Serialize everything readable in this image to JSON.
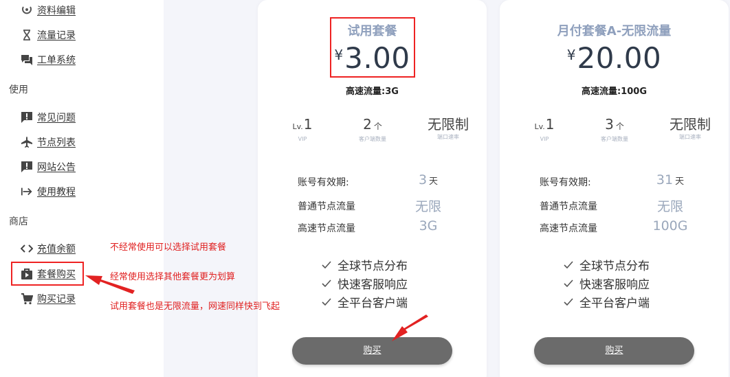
{
  "sidebar": {
    "items_top": [
      {
        "label": "资料编辑",
        "icon": "user-edit-icon"
      },
      {
        "label": "流量记录",
        "icon": "hourglass-icon"
      },
      {
        "label": "工单系统",
        "icon": "chat-bubbles-icon"
      }
    ],
    "section_use": "使用",
    "items_use": [
      {
        "label": "常见问题",
        "icon": "alert-message-icon"
      },
      {
        "label": "节点列表",
        "icon": "airplane-icon"
      },
      {
        "label": "网站公告",
        "icon": "announcement-icon"
      },
      {
        "label": "使用教程",
        "icon": "arrow-right-bar-icon"
      }
    ],
    "section_shop": "商店",
    "items_shop": [
      {
        "label": "充值余额",
        "icon": "code-brackets-icon"
      },
      {
        "label": "套餐购买",
        "icon": "shopping-bag-play-icon"
      },
      {
        "label": "购买记录",
        "icon": "cart-icon"
      }
    ]
  },
  "plans": [
    {
      "name": "试用套餐",
      "currency": "¥",
      "price": "3.00",
      "traffic": "高速流量:3G",
      "level_prefix": "Lv.",
      "level": "1",
      "level_caption": "VIP",
      "clients": "2",
      "clients_unit": "个",
      "clients_caption": "客户端数量",
      "speed": "无限制",
      "speed_caption": "端口速率",
      "rows": [
        {
          "key": "账号有效期:",
          "value": "3",
          "unit": "天"
        },
        {
          "key": "普通节点流量",
          "value": "无限",
          "unit": ""
        },
        {
          "key": "高速节点流量",
          "value": "3G",
          "unit": ""
        }
      ],
      "features": [
        "全球节点分布",
        "快速客服响应",
        "全平台客户端"
      ],
      "buy_label": "购买"
    },
    {
      "name": "月付套餐A-无限流量",
      "currency": "¥",
      "price": "20.00",
      "traffic": "高速流量:100G",
      "level_prefix": "Lv.",
      "level": "1",
      "level_caption": "VIP",
      "clients": "3",
      "clients_unit": "个",
      "clients_caption": "客户端数量",
      "speed": "无限制",
      "speed_caption": "端口速率",
      "rows": [
        {
          "key": "账号有效期:",
          "value": "31",
          "unit": "天"
        },
        {
          "key": "普通节点流量",
          "value": "无限",
          "unit": ""
        },
        {
          "key": "高速节点流量",
          "value": "100G",
          "unit": ""
        }
      ],
      "features": [
        "全球节点分布",
        "快速客服响应",
        "全平台客户端"
      ],
      "buy_label": "购买"
    }
  ],
  "annotations": {
    "note1": "不经常使用可以选择试用套餐",
    "note2": "经常使用选择其他套餐更为划算",
    "note3": "试用套餐也是无限流量，网速同样快到飞起",
    "color": "#e22222"
  },
  "colors": {
    "accent_plan_name": "#8fa0bd",
    "button": "#6b6b6b",
    "background": "#f4f5fa"
  }
}
